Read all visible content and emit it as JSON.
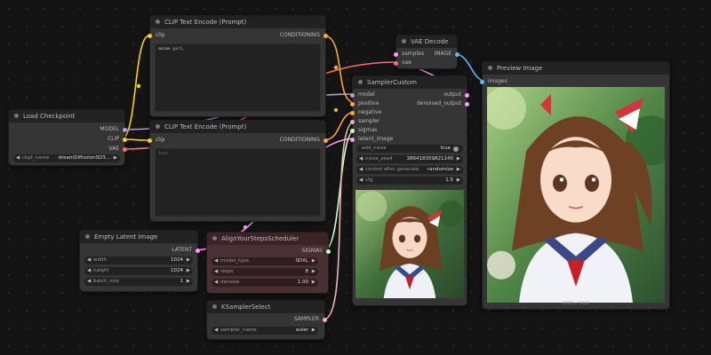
{
  "nodes": {
    "clip_pos": {
      "title": "CLIP Text Encode (Prompt)",
      "in_clip": "clip",
      "out_conditioning": "CONDITIONING",
      "text": "anime girl,"
    },
    "clip_neg": {
      "title": "CLIP Text Encode (Prompt)",
      "in_clip": "clip",
      "out_conditioning": "CONDITIONING",
      "text": "text"
    },
    "checkpoint": {
      "title": "Load Checkpoint",
      "out_model": "MODEL",
      "out_clip": "CLIP",
      "out_vae": "VAE",
      "ckpt_label": "ckpt_name",
      "ckpt_value": "dreamDiffusionSD3..."
    },
    "vae_decode": {
      "title": "VAE Decode",
      "in_samples": "samples",
      "in_vae": "vae",
      "out_image": "IMAGE"
    },
    "sampler_custom": {
      "title": "SamplerCustom",
      "in_model": "model",
      "in_positive": "positive",
      "in_negative": "negative",
      "in_sampler": "sampler",
      "in_sigmas": "sigmas",
      "in_latent": "latent_image",
      "out_output": "output",
      "out_denoised": "denoised_output",
      "add_noise_label": "add_noise",
      "add_noise_value": "true",
      "noise_seed_label": "noise_seed",
      "noise_seed_value": "386418359821140",
      "control_label": "control after generate",
      "control_value": "randomize",
      "cfg_label": "cfg",
      "cfg_value": "1.5"
    },
    "preview": {
      "title": "Preview Image",
      "in_images": "images",
      "caption": "1024 × 1024"
    },
    "empty_latent": {
      "title": "Empty Latent Image",
      "out_latent": "LATENT",
      "width_label": "width",
      "width_value": "1024",
      "height_label": "height",
      "height_value": "1024",
      "batch_label": "batch_size",
      "batch_value": "1"
    },
    "ays": {
      "title": "AlignYourStepsScheduler",
      "out_sigmas": "SIGMAS",
      "model_type_label": "model_type",
      "model_type_value": "SDXL",
      "steps_label": "steps",
      "steps_value": "8",
      "denoise_label": "denoise",
      "denoise_value": "1.00"
    },
    "ksampler_select": {
      "title": "KSamplerSelect",
      "out_sampler": "SAMPLER",
      "sampler_label": "sampler_name",
      "sampler_value": "euler"
    }
  },
  "colors": {
    "background": "#141414",
    "node_body": "#353535",
    "node_title": "#222222",
    "ays_body": "#4a2f33",
    "ays_title": "#3b2326",
    "model_link": "#b39ddb",
    "clip_link": "#ffd500",
    "vae_link": "#ff6e6e",
    "conditioning_link": "#ffa931",
    "latent_link": "#ff9cf9",
    "image_link": "#64b5f6",
    "sigmas_link": "#cdffcd",
    "sampler_link": "#ecb4b4"
  }
}
